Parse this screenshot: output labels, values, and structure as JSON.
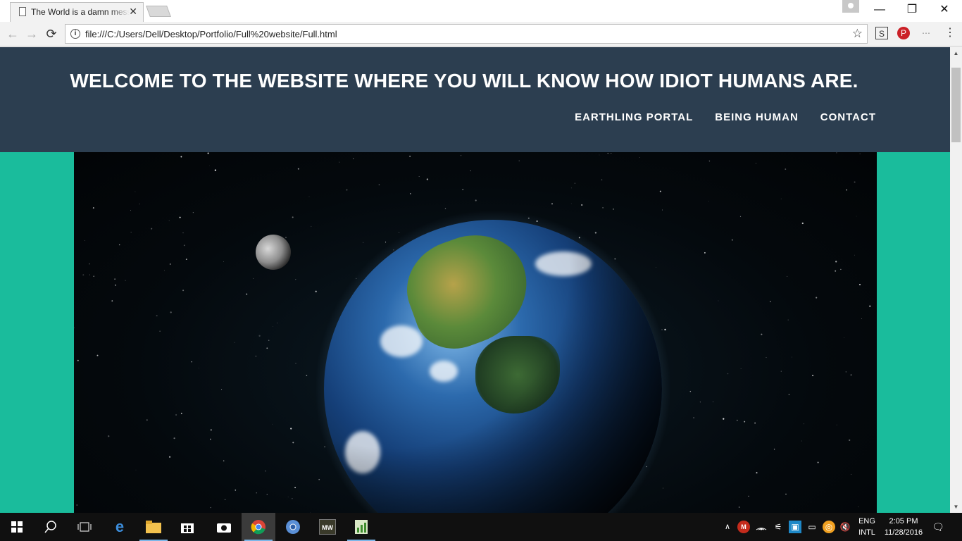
{
  "browser": {
    "tab_title": "The World is a damn mess",
    "tab_close": "✕",
    "url": "file:///C:/Users/Dell/Desktop/Portfolio/Full%20website/Full.html",
    "window_controls": {
      "minimize": "—",
      "restore": "❐",
      "close": "✕"
    },
    "nav": {
      "back": "←",
      "forward": "→",
      "reload": "⟳"
    },
    "extensions": {
      "s_ext": "S",
      "pinterest": "P",
      "more": "⋯",
      "menu": "⋮"
    }
  },
  "site": {
    "title": "WELCOME TO THE WEBSITE WHERE YOU WILL KNOW HOW IDIOT HUMANS ARE.",
    "nav": [
      "EARTHLING PORTAL",
      "BEING HUMAN",
      "CONTACT"
    ],
    "colors": {
      "header_bg": "#2c3e50",
      "page_bg": "#1abc9c"
    }
  },
  "taskbar": {
    "language_top": "ENG",
    "language_bottom": "INTL",
    "time": "2:05 PM",
    "date": "11/28/2016",
    "icons": [
      "windows-start-icon",
      "search-icon",
      "task-view-icon",
      "edge-icon",
      "file-explorer-icon",
      "store-icon",
      "camera-icon",
      "chrome-icon",
      "chrome-canary-icon",
      "game-icon",
      "app-icon"
    ]
  }
}
